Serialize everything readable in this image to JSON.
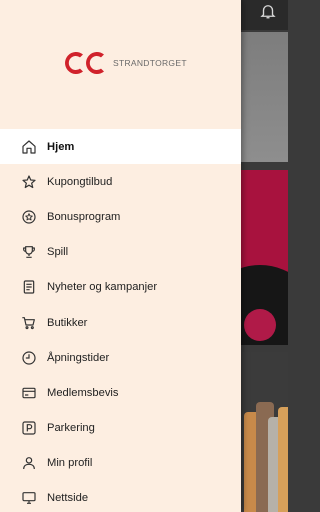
{
  "app": {
    "logo_text": "STRANDTORGET",
    "brand_color": "#d0222b"
  },
  "nav": {
    "items": [
      {
        "label": "Hjem",
        "icon": "home-icon",
        "active": true
      },
      {
        "label": "Kupongtilbud",
        "icon": "star-icon"
      },
      {
        "label": "Bonusprogram",
        "icon": "badge-star-icon"
      },
      {
        "label": "Spill",
        "icon": "trophy-icon"
      },
      {
        "label": "Nyheter og kampanjer",
        "icon": "document-icon"
      },
      {
        "label": "Butikker",
        "icon": "cart-icon"
      },
      {
        "label": "Åpningstider",
        "icon": "clock-icon"
      },
      {
        "label": "Medlemsbevis",
        "icon": "card-icon"
      },
      {
        "label": "Parkering",
        "icon": "parking-icon"
      },
      {
        "label": "Min profil",
        "icon": "person-icon"
      },
      {
        "label": "Nettside",
        "icon": "monitor-icon"
      }
    ]
  },
  "background": {
    "notification_icon": "bell-icon"
  }
}
